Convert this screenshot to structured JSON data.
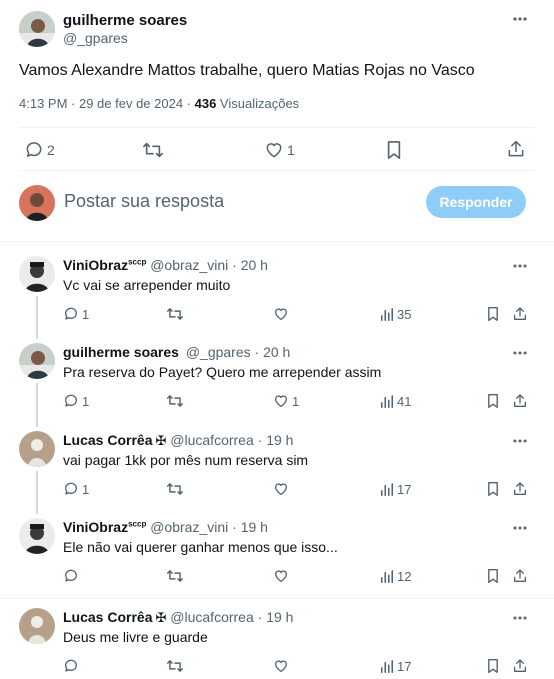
{
  "main_tweet": {
    "author_name": "guilherme soares",
    "author_handle": "@_gpares",
    "text": "Vamos Alexandre Mattos trabalhe, quero Matias Rojas no Vasco",
    "time": "4:13 PM · 29 de fev de 2024 · ",
    "views_count": "436",
    "views_label": " Visualizações",
    "replies": "2",
    "likes": "1"
  },
  "reply_box": {
    "placeholder": "Postar sua resposta",
    "button_label": "Responder"
  },
  "replies": [
    {
      "name": "ViniObraz",
      "name_suffix": "sccp",
      "handle": "@obraz_vini",
      "time": " · 20 h",
      "text": "Vc vai se arrepender muito",
      "replies": "1",
      "retweets": "",
      "likes": "",
      "views": "35"
    },
    {
      "name": "guilherme soares",
      "name_suffix": "",
      "handle": "@_gpares",
      "time": " · 20 h",
      "text": "Pra reserva do Payet? Quero me arrepender assim",
      "replies": "1",
      "retweets": "",
      "likes": "1",
      "views": "41"
    },
    {
      "name": "Lucas Corrêa",
      "name_suffix": "✠",
      "handle": "@lucafcorrea",
      "time": " · 19 h",
      "text": "vai pagar 1kk por mês num reserva sim",
      "replies": "1",
      "retweets": "",
      "likes": "",
      "views": "17"
    },
    {
      "name": "ViniObraz",
      "name_suffix": "sccp",
      "handle": "@obraz_vini",
      "time": " · 19 h",
      "text": "Ele não vai querer ganhar menos que isso...",
      "replies": "",
      "retweets": "",
      "likes": "",
      "views": "12"
    },
    {
      "name": "Lucas Corrêa",
      "name_suffix": "✠",
      "handle": "@lucafcorrea",
      "time": " · 19 h",
      "text": "Deus me livre e guarde",
      "replies": "",
      "retweets": "",
      "likes": "",
      "views": "17"
    }
  ],
  "colors": {
    "text": "#0f1419",
    "secondary": "#536471",
    "button_disabled": "#8ecdf8",
    "divider": "#eff3f4",
    "thread_line": "#cfd9de"
  }
}
